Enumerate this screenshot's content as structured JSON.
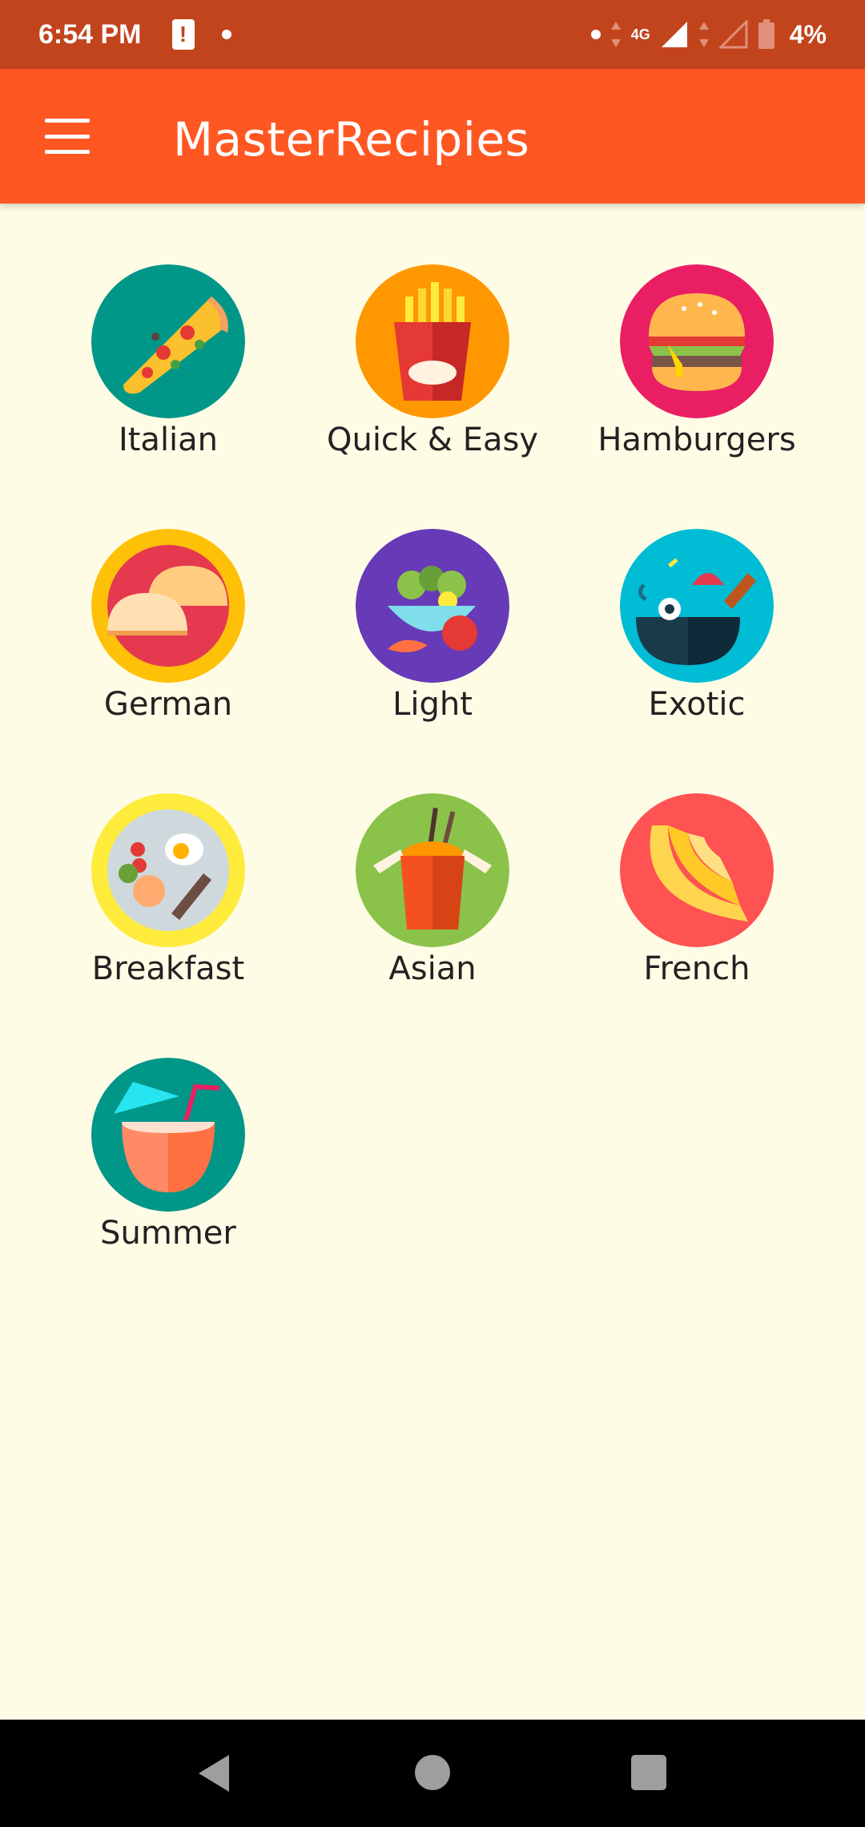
{
  "status_bar": {
    "time": "6:54 PM",
    "alert_glyph": "!",
    "network": "4G",
    "battery": "4%"
  },
  "app_bar": {
    "title": "MasterRecipies",
    "menu_icon": "hamburger-menu-icon"
  },
  "categories": [
    {
      "label": "Italian",
      "icon": "pizza-icon",
      "color": "#009688"
    },
    {
      "label": "Quick & Easy",
      "icon": "fries-icon",
      "color": "#FF9800"
    },
    {
      "label": "Hamburgers",
      "icon": "burger-icon",
      "color": "#E91E63"
    },
    {
      "label": "German",
      "icon": "dumpling-icon",
      "color": "#FFC107"
    },
    {
      "label": "Light",
      "icon": "salad-icon",
      "color": "#673AB7"
    },
    {
      "label": "Exotic",
      "icon": "wok-icon",
      "color": "#00BCD4"
    },
    {
      "label": "Breakfast",
      "icon": "breakfast-plate-icon",
      "color": "#FFEB3B"
    },
    {
      "label": "Asian",
      "icon": "noodle-box-icon",
      "color": "#8BC34A"
    },
    {
      "label": "French",
      "icon": "croissant-icon",
      "color": "#FF5252"
    },
    {
      "label": "Summer",
      "icon": "coconut-drink-icon",
      "color": "#009688"
    }
  ],
  "nav_bar": {
    "back": "back-icon",
    "home": "home-icon",
    "recents": "recents-icon"
  }
}
